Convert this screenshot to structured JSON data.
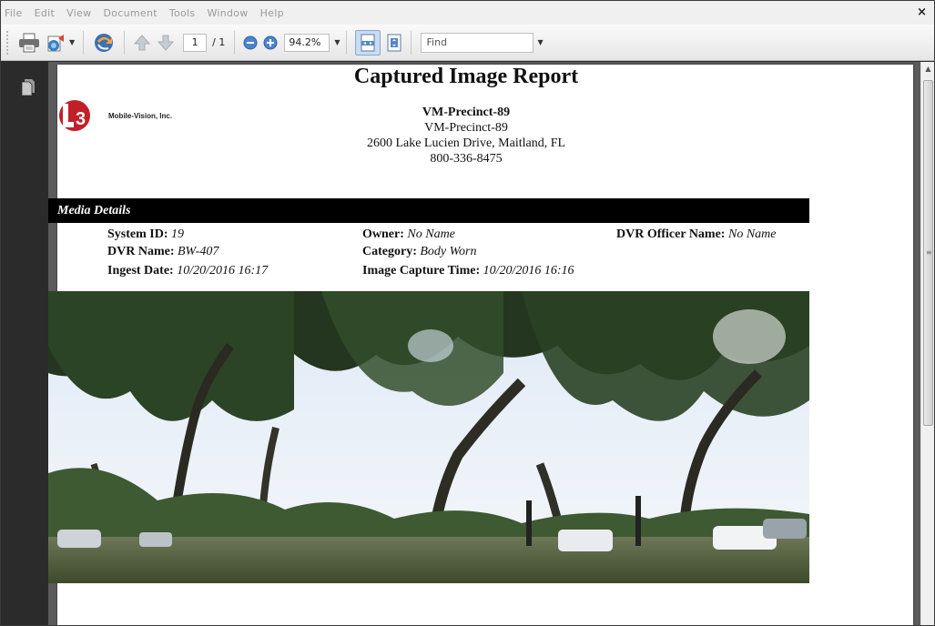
{
  "menu": {
    "items": [
      "File",
      "Edit",
      "View",
      "Document",
      "Tools",
      "Window",
      "Help"
    ],
    "close_symbol": "×"
  },
  "toolbar": {
    "page_current": "1",
    "page_total": "/ 1",
    "zoom": "94.2%",
    "find_placeholder": "Find",
    "icons": [
      "print-icon",
      "share-icon",
      "sync-icon",
      "prev-page-icon",
      "next-page-icon",
      "zoom-out-icon",
      "zoom-in-icon",
      "fit-width-icon",
      "fit-page-icon"
    ]
  },
  "leftnav": {
    "icon": "pages-panel-icon"
  },
  "report": {
    "title": "Captured Image Report",
    "logo_mark": "3",
    "logo_text": "Mobile-Vision, Inc.",
    "precinct_bold": "VM-Precinct-89",
    "precinct": "VM-Precinct-89",
    "address": "2600 Lake Lucien Drive, Maitland, FL",
    "phone": "800-336-8475",
    "section_title": "Media Details",
    "fields": {
      "system_id": {
        "label": "System ID:",
        "value": "19"
      },
      "owner": {
        "label": "Owner:",
        "value": "No Name"
      },
      "officer": {
        "label": "DVR Officer Name:",
        "value": "No Name"
      },
      "dvr_name": {
        "label": "DVR Name:",
        "value": "BW-407"
      },
      "category": {
        "label": "Category:",
        "value": "Body Worn"
      },
      "ingest_date": {
        "label": "Ingest Date:",
        "value": "10/20/2016 16:17"
      },
      "capture_time": {
        "label": "Image Capture Time:",
        "value": "10/20/2016 16:16"
      }
    }
  },
  "colors": {
    "accent_red": "#c0202a",
    "section_bar": "#000000",
    "doc_background": "#5b5b5b",
    "sidebar": "#2b2b2b"
  }
}
